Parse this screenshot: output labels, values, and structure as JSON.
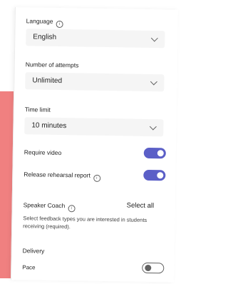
{
  "language": {
    "label": "Language",
    "info_icon": "info-icon",
    "value": "English"
  },
  "attempts": {
    "label": "Number of attempts",
    "value": "Unlimited"
  },
  "time_limit": {
    "label": "Time limit",
    "value": "10 minutes"
  },
  "require_video": {
    "label": "Require video",
    "on": true
  },
  "release_report": {
    "label": "Release rehearsal report",
    "on": true
  },
  "speaker_coach": {
    "label": "Speaker Coach",
    "select_all": "Select all",
    "help": "Select feedback types you are interested in students receiving (required)."
  },
  "delivery": {
    "label": "Delivery",
    "pace_label": "Pace",
    "pace_on": false
  },
  "colors": {
    "toggle_on": "#5b5fc7",
    "accent_strip": "#f08080"
  }
}
